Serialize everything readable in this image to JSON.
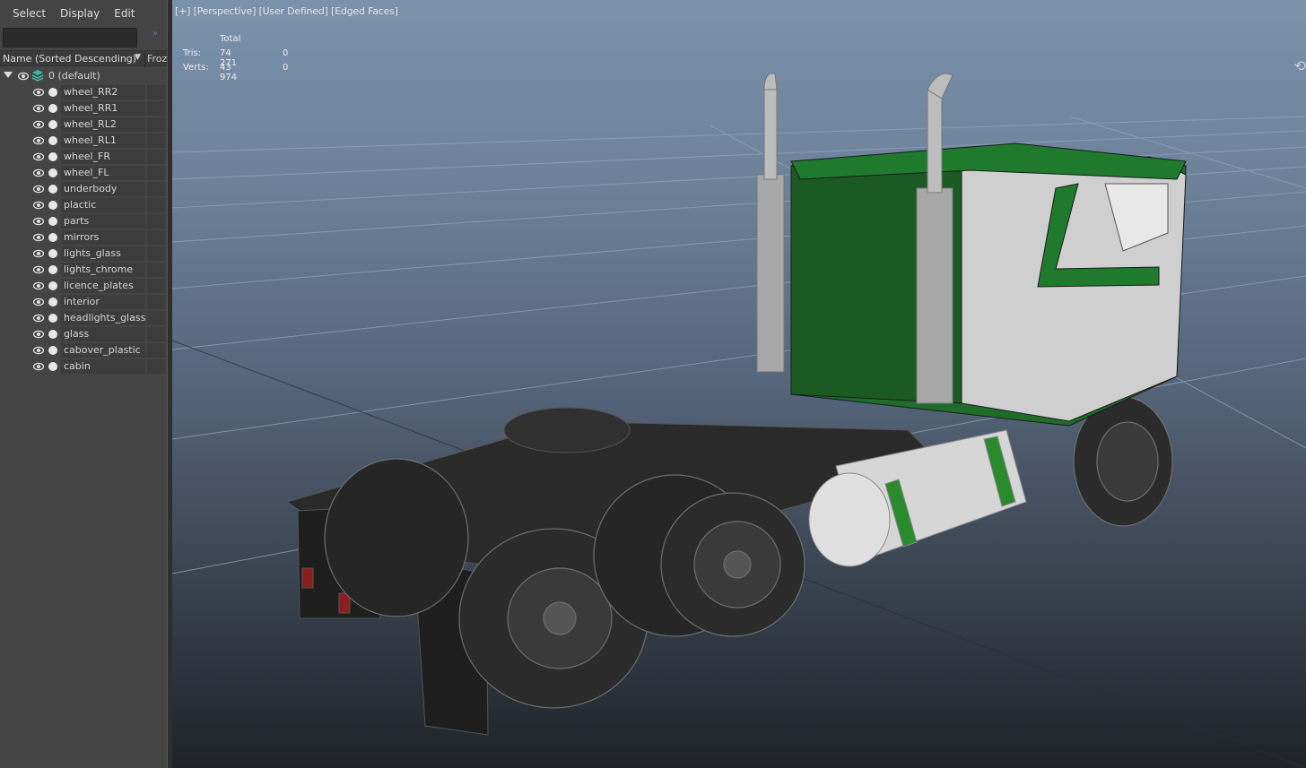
{
  "menu": {
    "select": "Select",
    "display": "Display",
    "edit": "Edit"
  },
  "search": {
    "value": "",
    "expand_glyph": "»"
  },
  "columns": {
    "name": "Name (Sorted Descending)",
    "sort_glyph": "▼",
    "frozen": "Froz"
  },
  "root": {
    "label": "0 (default)",
    "icon": "layers-icon"
  },
  "layers": [
    {
      "label": "wheel_RR2"
    },
    {
      "label": "wheel_RR1"
    },
    {
      "label": "wheel_RL2"
    },
    {
      "label": "wheel_RL1"
    },
    {
      "label": "wheel_FR"
    },
    {
      "label": "wheel_FL"
    },
    {
      "label": "underbody"
    },
    {
      "label": "plactic"
    },
    {
      "label": "parts"
    },
    {
      "label": "mirrors"
    },
    {
      "label": "lights_glass"
    },
    {
      "label": "lights_chrome"
    },
    {
      "label": "licence_plates"
    },
    {
      "label": "interior"
    },
    {
      "label": "headlights_glass"
    },
    {
      "label": "glass"
    },
    {
      "label": "cabover_plastic"
    },
    {
      "label": "cabin"
    }
  ],
  "viewport": {
    "header": "[+] [Perspective] [User Defined] [Edged Faces]",
    "hud": {
      "total_label": "Total",
      "tris_label": "Tris:",
      "tris_total": "74 271",
      "tris_sel": "0",
      "verts_label": "Verts:",
      "verts_total": "43 974",
      "verts_sel": "0"
    },
    "nav_icon": "orbit-icon"
  },
  "colors": {
    "accent_green": "#1f7a2e",
    "panel": "#444444",
    "sky_top": "#7b92ad"
  }
}
